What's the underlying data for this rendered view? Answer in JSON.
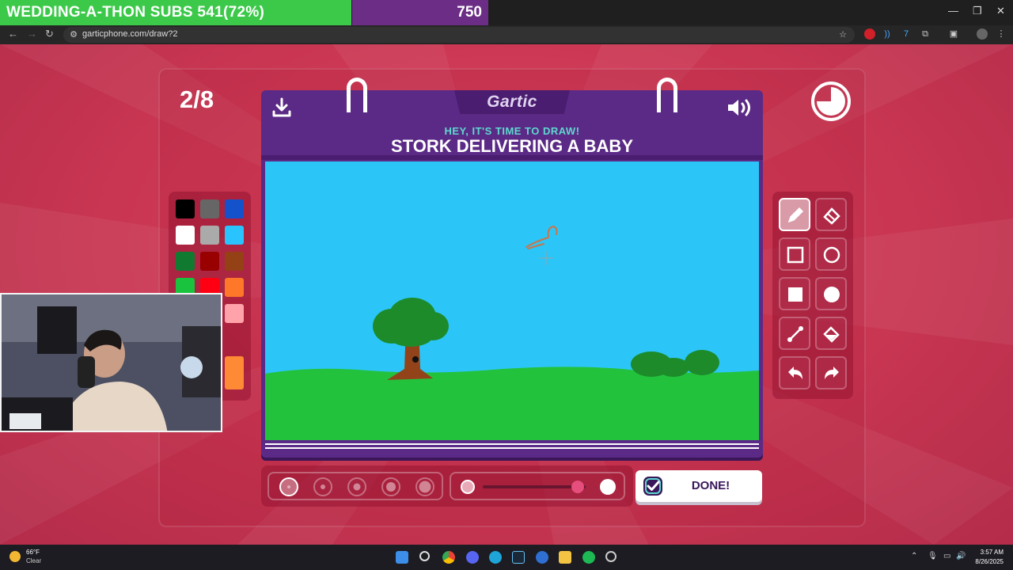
{
  "overlay": {
    "subs_text": "WEDDING-A-THON SUBS  541(72%)",
    "subs_progress": 0.72,
    "count": "750"
  },
  "browser": {
    "url": "garticphone.com/draw?2"
  },
  "game": {
    "round": "2/8",
    "logo": "Gartic",
    "subtitle": "HEY, IT'S TIME TO DRAW!",
    "prompt": "STORK DELIVERING A BABY",
    "done_label": "DONE!",
    "palette": [
      "#000000",
      "#666666",
      "#1452cc",
      "#ffffff",
      "#aaaaaa",
      "#29c3ff",
      "#117a31",
      "#990000",
      "#944116",
      "#19c33d",
      "#ff0013",
      "#ff7829",
      "#b0701c",
      "#cc4e5a",
      "#ffa2a9",
      "#ff8a35"
    ],
    "active_tool": "pencil",
    "brush_sizes": 5,
    "active_size": 0,
    "opacity": 0.92,
    "canvas": {
      "sky": "#2bc6f7",
      "grass": "#23c23d",
      "tree_foliage": "#1d8b2a",
      "trunk": "#934319",
      "bush": "#1d8b2a",
      "hanger": "#c9754a"
    }
  },
  "taskbar": {
    "weather_temp": "66°F",
    "weather_desc": "Clear",
    "time": "3:57 AM",
    "date": "8/26/2025"
  }
}
